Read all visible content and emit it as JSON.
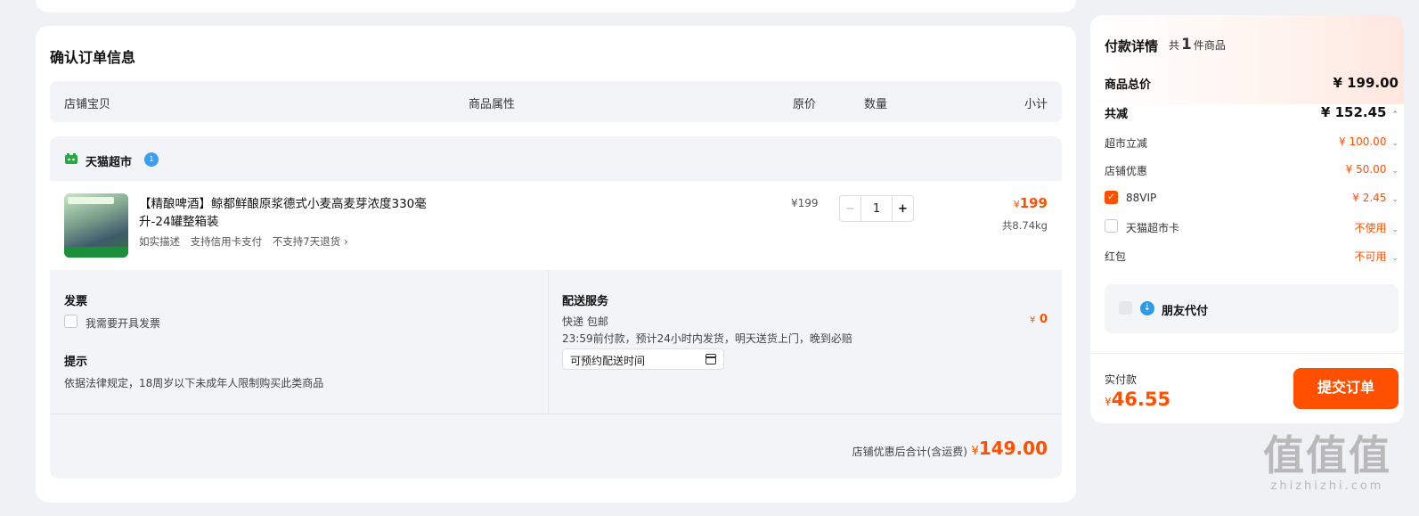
{
  "confirm": {
    "title": "确认订单信息",
    "headers": [
      "店铺宝贝",
      "商品属性",
      "原价",
      "数量",
      "小计"
    ]
  },
  "store": {
    "name": "天猫超市",
    "badge": "1",
    "item": {
      "title": "【精酿啤酒】鲸都鲜酿原浆德式小麦高麦芽浓度330毫升-24罐整箱装",
      "tags": [
        "如实描述",
        "支持信用卡支付",
        "不支持7天退货"
      ],
      "price": "¥199",
      "quantity": "1",
      "subtotal_symbol": "¥",
      "subtotal": "199",
      "weight": "共8.74kg"
    },
    "invoice": {
      "heading": "发票",
      "option": "我需要开具发票"
    },
    "notice": {
      "heading": "提示",
      "text": "依据法律规定，18周岁以下未成年人限制购买此类商品"
    },
    "delivery": {
      "heading": "配送服务",
      "method": "快递 包邮",
      "detail": "23:59前付款，预计24小时内发货，明天送货上门，晚到必赔",
      "time_placeholder": "可预约配送时间",
      "price_symbol": "¥",
      "price": "0"
    },
    "footer": {
      "label": "店铺优惠后合计(含运费)",
      "symbol": "¥",
      "total": "149.00"
    }
  },
  "payment": {
    "title": "付款详情",
    "count_prefix": "共",
    "count": "1",
    "count_suffix": "件商品",
    "total_label": "商品总价",
    "total": "¥ 199.00",
    "discount_label": "共减",
    "discount": "¥ 152.45",
    "rows": [
      {
        "label": "超市立减",
        "value": "¥ 100.00"
      },
      {
        "label": "店铺优惠",
        "value": "¥ 50.00"
      },
      {
        "label": "88VIP",
        "value": "¥ 2.45"
      },
      {
        "label": "天猫超市卡",
        "value": "不使用"
      },
      {
        "label": "红包",
        "value": "不可用"
      }
    ],
    "friend_pay": "朋友代付",
    "paid_label": "实付款",
    "paid_symbol": "¥",
    "paid": "46.55",
    "submit": "提交订单"
  },
  "watermark": {
    "big": "值值值",
    "small": "zhizhizhi.com"
  },
  "colors": {
    "accent": "#ff5000",
    "background": "#f0f1f4",
    "panel": "#f2f4f7"
  }
}
